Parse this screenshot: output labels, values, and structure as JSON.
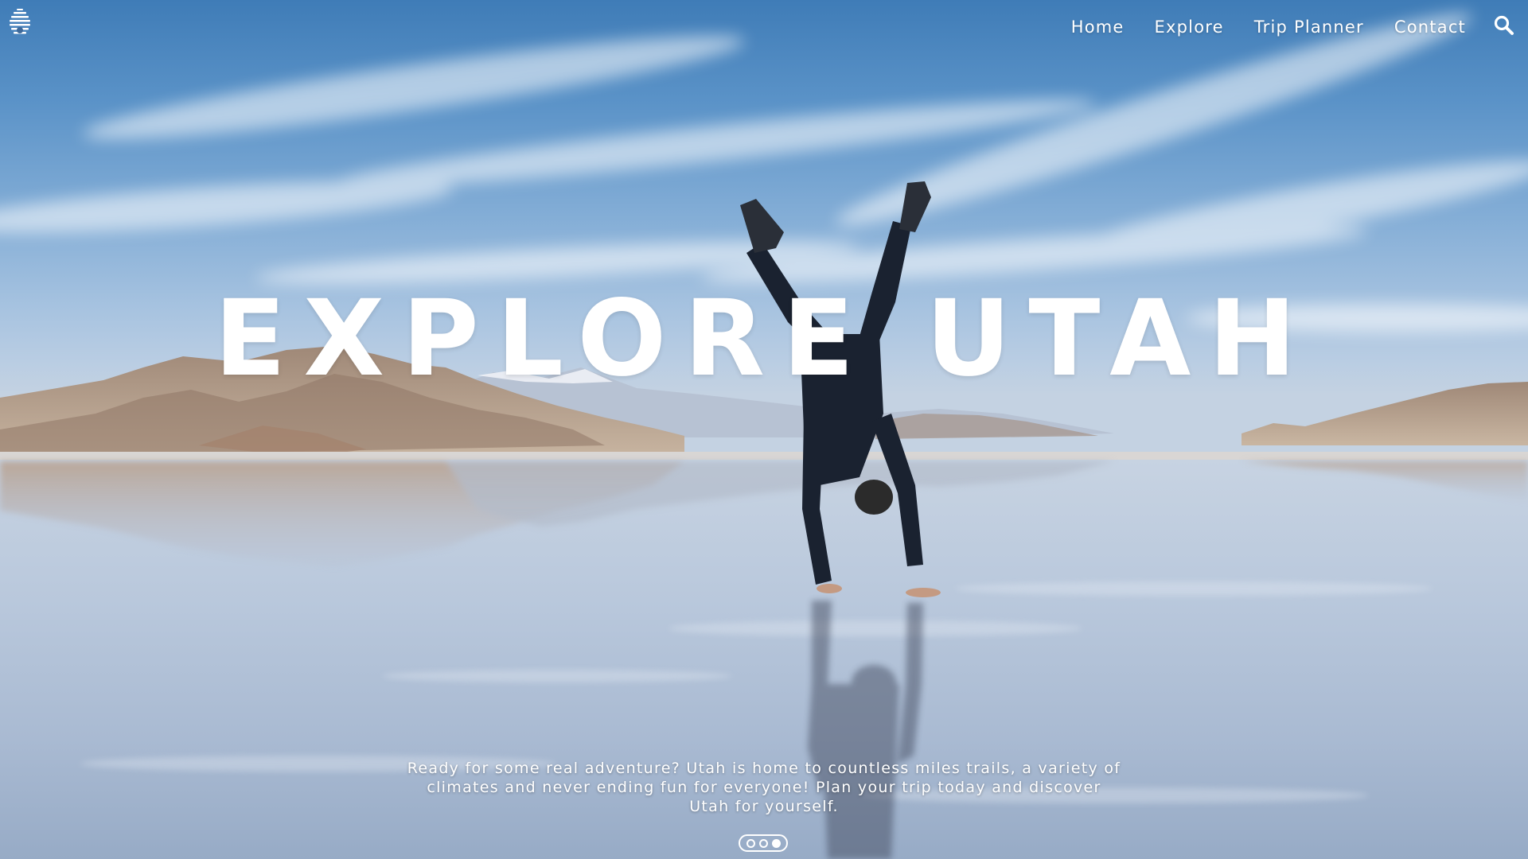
{
  "nav": {
    "logo_icon": "beehive-icon",
    "links": [
      {
        "label": "Home"
      },
      {
        "label": "Explore"
      },
      {
        "label": "Trip Planner"
      },
      {
        "label": "Contact"
      }
    ],
    "search_icon": "search-icon"
  },
  "hero": {
    "title": "EXPLORE UTAH",
    "description": "Ready for some real adventure? Utah is home to countless miles trails, a variety of climates and never ending fun for everyone! Plan your trip today and discover Utah for yourself."
  },
  "carousel": {
    "slides": 3,
    "active_index": 2
  },
  "colors": {
    "sky_top": "#3f7cb7",
    "sky_horizon": "#c4d2e2",
    "text": "#ffffff",
    "mountain": "#a58f7b",
    "figure": "#1a2230"
  }
}
